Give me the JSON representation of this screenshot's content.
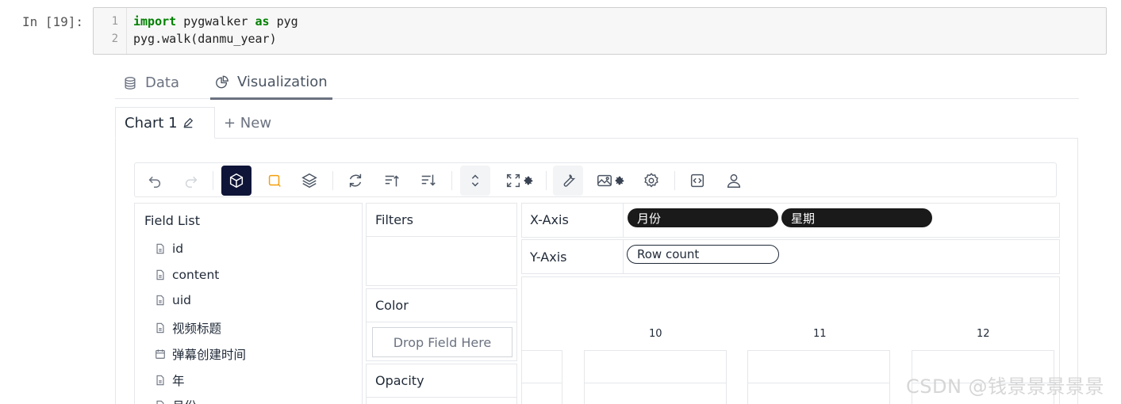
{
  "cell": {
    "prompt": "In [19]:",
    "line_numbers": [
      "1",
      "2"
    ],
    "line1": {
      "kw1": "import",
      "mid": " pygwalker ",
      "kw2": "as",
      "tail": " pyg"
    },
    "line2": "pyg.walk(danmu_year)"
  },
  "tabs": {
    "data": "Data",
    "visualization": "Visualization",
    "active": "Visualization"
  },
  "chart_tabs": {
    "chart1": "Chart 1",
    "new": "+ New"
  },
  "toolbar": {
    "icons": [
      "undo-icon",
      "redo-icon",
      "cube-icon",
      "lasso-icon",
      "layers-icon",
      "refresh-icon",
      "sort-ascending-icon",
      "sort-descending-icon",
      "expand-vertical-icon",
      "resize-icon",
      "gear-icon",
      "wrench-icon",
      "image-icon",
      "gear-icon",
      "settings-icon",
      "code-icon",
      "user-icon"
    ],
    "active_color": "#0f1538"
  },
  "field_list": {
    "title": "Field List",
    "fields": [
      {
        "name": "id",
        "type": "text"
      },
      {
        "name": "content",
        "type": "text"
      },
      {
        "name": "uid",
        "type": "text"
      },
      {
        "name": "视频标题",
        "type": "text"
      },
      {
        "name": "弹幕创建时间",
        "type": "date"
      },
      {
        "name": "年",
        "type": "text"
      },
      {
        "name": "月份",
        "type": "text"
      }
    ]
  },
  "encodings": {
    "filters": "Filters",
    "color": "Color",
    "drop_here": "Drop Field Here",
    "opacity": "Opacity"
  },
  "axes": {
    "x_label": "X-Axis",
    "x_fields": [
      "月份",
      "星期"
    ],
    "y_label": "Y-Axis",
    "y_fields": [
      "Row count"
    ]
  },
  "chart": {
    "facets": [
      "10",
      "11",
      "12"
    ]
  },
  "watermark": "CSDN @钱景景景景景"
}
